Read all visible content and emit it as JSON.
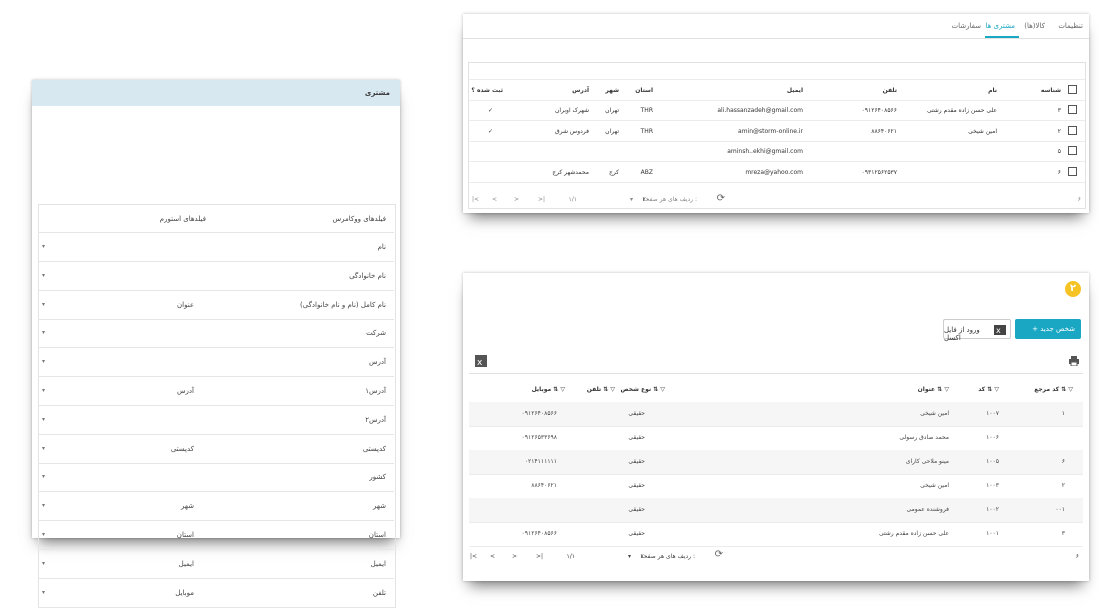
{
  "mapping_panel": {
    "title": "مشتری",
    "col_woocommerce": "فیلدهای ووکامرس",
    "col_istorm": "فیلدهای استورم",
    "rows": [
      {
        "field": "نام",
        "mapped": ""
      },
      {
        "field": "نام خانوادگی",
        "mapped": ""
      },
      {
        "field": "نام کامل (نام و نام خانوادگی)",
        "mapped": "عنوان"
      },
      {
        "field": "شرکت",
        "mapped": ""
      },
      {
        "field": "آدرس",
        "mapped": ""
      },
      {
        "field": "آدرس۱",
        "mapped": "آدرس"
      },
      {
        "field": "آدرس۲",
        "mapped": ""
      },
      {
        "field": "کدپستی",
        "mapped": "کدپستی"
      },
      {
        "field": "کشور",
        "mapped": ""
      },
      {
        "field": "شهر",
        "mapped": "شهر"
      },
      {
        "field": "استان",
        "mapped": "استان"
      },
      {
        "field": "ایمیل",
        "mapped": "ایمیل"
      },
      {
        "field": "تلفن",
        "mapped": "موبایل"
      }
    ],
    "arrow": "▾"
  },
  "customers_panel": {
    "tabs": [
      "تنظیمات",
      "کالا(ها)",
      "مشتری ها",
      "سفارشات"
    ],
    "active_tab": "مشتری ها",
    "headers": {
      "id": "شناسه",
      "name": "نام",
      "phone": "تلفن",
      "email": "ایمیل",
      "province": "استان",
      "city": "شهر",
      "address": "آدرس",
      "registered": "ثبت شده ؟"
    },
    "rows": [
      {
        "id": "۳",
        "name": "علی حسن زاده مقدم رشتی",
        "phone": "۰۹۱۲۶۴۰۸۵۶۶",
        "email": "ali.hassanzadeh@gmail.com",
        "province": "THR",
        "city": "تهران",
        "address": "شهرک اوبران",
        "registered": "✓"
      },
      {
        "id": "۲",
        "name": "امین شیخی",
        "phone": "۸۸۶۴۰۶۲۱",
        "email": "amin@storm-online.ir",
        "province": "THR",
        "city": "تهران",
        "address": "فردوس شرق",
        "registered": "✓"
      },
      {
        "id": "۵",
        "name": "",
        "phone": "",
        "email": "aminsh..ekhi@gmail.com",
        "province": "",
        "city": "",
        "address": "",
        "registered": ""
      },
      {
        "id": "۶",
        "name": "",
        "phone": "۰۹۳۱۲۵۶۲۵۳۷",
        "email": "mreza@yahoo.com",
        "province": "ABZ",
        "city": "کرج",
        "address": "محمدشهر کرج",
        "registered": ""
      }
    ],
    "pager": {
      "rows_per_page_label": "ردیف های هر صفحه :",
      "rows_per_page": "۲۰",
      "page": "۱/۱",
      "count": "۶"
    }
  },
  "persons_panel": {
    "step": "۲",
    "new_person_label": "+ شخص جدید",
    "import_excel_label": "ورود از فایل اکسل",
    "headers": {
      "ref": "کد مرجع",
      "code": "کد",
      "title": "عنوان",
      "type": "نوع شخص",
      "phone": "تلفن",
      "mobile": "موبایل"
    },
    "rows": [
      {
        "ref": "۱",
        "code": "۱۰۰۷",
        "title": "امین شیخی",
        "type": "حقیقی",
        "phone": "",
        "mobile": "۰۹۱۲۶۴۰۸۵۶۶"
      },
      {
        "ref": "",
        "code": "۱۰۰۶",
        "title": "محمد صادق رسولی",
        "type": "حقیقی",
        "phone": "",
        "mobile": "۰۹۱۲۶۵۳۳۶۹۸"
      },
      {
        "ref": "۶",
        "code": "۱۰۰۵",
        "title": "مینو ملاحی کارای",
        "type": "حقیقی",
        "phone": "",
        "mobile": "۰۲۱۴۱۱۱۱۱۱"
      },
      {
        "ref": "۲",
        "code": "۱۰۰۳",
        "title": "امین شیخی",
        "type": "حقیقی",
        "phone": "",
        "mobile": "۸۸۶۴۰۶۲۱"
      },
      {
        "ref": "۰۰۱",
        "code": "۱۰۰۲",
        "title": "فروشنده عمومی",
        "type": "حقیقی",
        "phone": "",
        "mobile": ""
      },
      {
        "ref": "۳",
        "code": "۱۰۰۱",
        "title": "علی حسن زاده مقدم رشتی",
        "type": "حقیقی",
        "phone": "",
        "mobile": "۰۹۱۲۶۴۰۸۵۶۶"
      }
    ],
    "pager": {
      "rows_per_page_label": "ردیف های هر صفحه :",
      "rows_per_page": "۲۰",
      "page": "۱/۱",
      "count": "۶"
    }
  },
  "colors": {
    "accent": "#1aa7c4",
    "header_band": "#d8e8f0",
    "badge": "#f6c324"
  },
  "icons": [
    "first-page-icon",
    "prev-page-icon",
    "next-page-icon",
    "last-page-icon",
    "refresh-icon",
    "print-icon",
    "excel-icon",
    "sort-icon",
    "filter-icon",
    "checkbox-icon"
  ]
}
